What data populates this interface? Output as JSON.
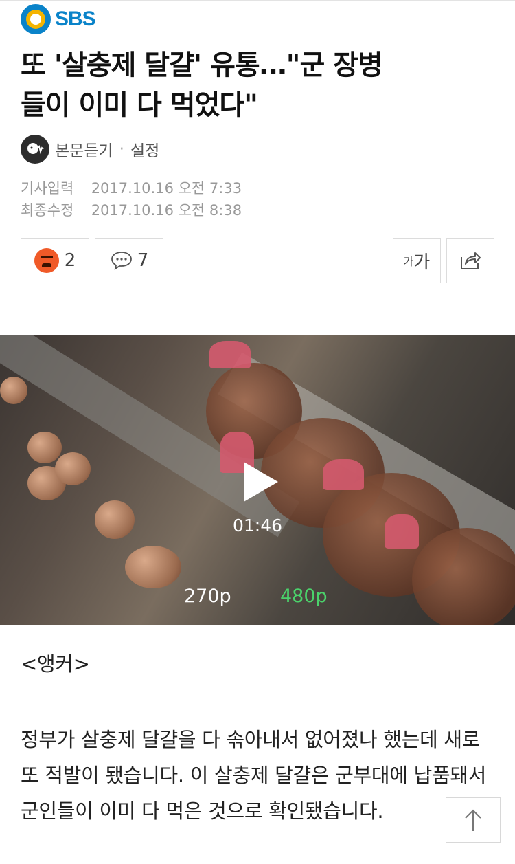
{
  "header": {
    "logo_text": "SBS"
  },
  "article": {
    "title": "또 '살충제 달걀' 유통…\"군 장병들이 이미 다 먹었다\"",
    "listen_label": "본문듣기",
    "settings_label": "설정",
    "meta": [
      {
        "label": "기사입력",
        "value": "2017.10.16 오전 7:33"
      },
      {
        "label": "최종수정",
        "value": "2017.10.16 오전 8:38"
      }
    ]
  },
  "actions": {
    "reaction_count": "2",
    "comment_count": "7",
    "font_small": "가",
    "font_big": "가"
  },
  "video": {
    "duration": "01:46",
    "quality_options": [
      "270p",
      "480p"
    ],
    "selected_quality": "480p"
  },
  "body": {
    "anchor": "<앵커>",
    "paragraph": "정부가 살충제 달걀을 다 솎아내서 없어졌나 했는데 새로 또 적발이 됐습니다. 이 살충제 달걀은 군부대에 납품돼서 군인들이 이미 다 먹은 것으로 확인됐습니다."
  },
  "colors": {
    "brand": "#0a83c9",
    "selected_quality": "#4bd26b"
  },
  "icons": [
    "sbs-logo-icon",
    "listen-icon",
    "angry-reaction-icon",
    "comment-icon",
    "share-icon",
    "arrow-up-icon",
    "play-icon"
  ]
}
